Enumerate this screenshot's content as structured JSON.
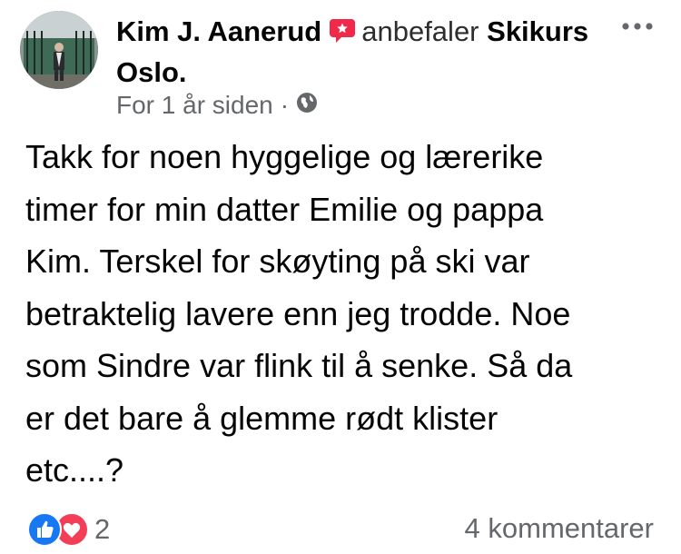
{
  "post": {
    "author": "Kim J. Aanerud",
    "verb": "anbefaler",
    "target": "Skikurs Oslo.",
    "timestamp": "For 1 år siden",
    "privacy_icon": "globe-icon",
    "text_lines": [
      "Takk for noen hyggelige og lærerike",
      "timer for min datter Emilie og pappa",
      "Kim. Terskel for skøyting på ski var",
      "betraktelig lavere enn jeg trodde. Noe",
      "som Sindre var flink til å senke. Så da",
      "er det bare å glemme rødt klister",
      "etc....?"
    ]
  },
  "reactions": {
    "icons": [
      "like-icon",
      "love-icon"
    ],
    "count": "2"
  },
  "comments": {
    "label": "4 kommentarer"
  },
  "colors": {
    "recommend_badge": "#f02849",
    "like_blue": "#1877f2",
    "love_red": "#f33e58",
    "secondary_text": "#65676b"
  }
}
